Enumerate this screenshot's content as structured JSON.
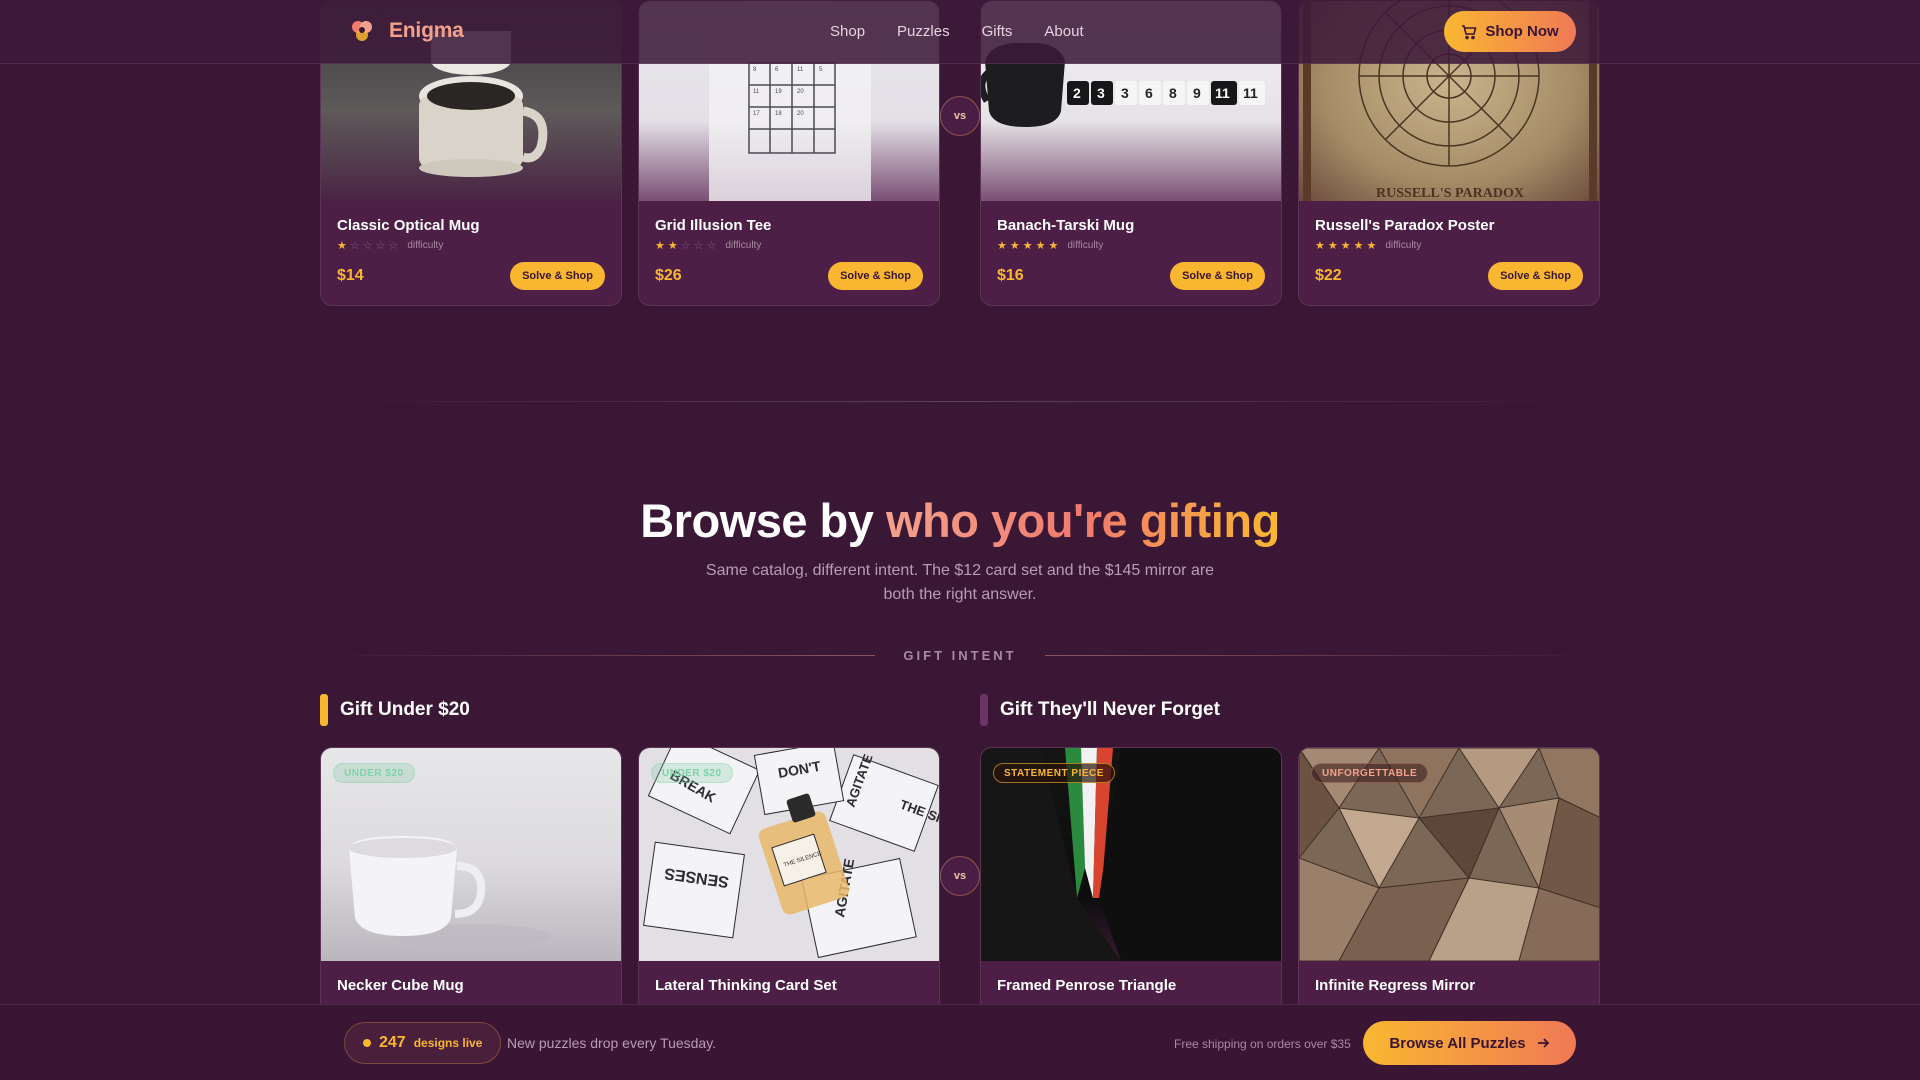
{
  "header": {
    "brand": "Enigma",
    "nav": [
      "Shop",
      "Puzzles",
      "Gifts",
      "About"
    ],
    "cta": "Shop Now"
  },
  "top_products": [
    {
      "name": "Classic Optical Mug",
      "rating": 1,
      "difficulty_label": "difficulty",
      "price": "$14",
      "button": "Solve & Shop"
    },
    {
      "name": "Grid Illusion Tee",
      "rating": 2,
      "difficulty_label": "difficulty",
      "price": "$26",
      "button": "Solve & Shop"
    },
    {
      "name": "Banach-Tarski Mug",
      "rating": 5,
      "difficulty_label": "difficulty",
      "price": "$16",
      "button": "Solve & Shop"
    },
    {
      "name": "Russell's Paradox Poster",
      "rating": 5,
      "difficulty_label": "difficulty",
      "price": "$22",
      "button": "Solve & Shop"
    }
  ],
  "vs_label": "vs",
  "poster_caption": "RUSSELL'S PARADOX",
  "mug_numbers": [
    "2",
    "3",
    "3",
    "6",
    "8",
    "9",
    "11",
    "11"
  ],
  "section": {
    "title_plain": "Browse by ",
    "title_highlight": "who you're gifting",
    "subtitle": "Same catalog, different intent. The $12 card set and the $145 mirror are both the right answer.",
    "intent_label": "GIFT INTENT"
  },
  "columns": [
    {
      "title": "Gift Under $20",
      "bar_color": "#f9b731"
    },
    {
      "title": "Gift They'll Never Forget",
      "bar_color": "#6b3466"
    }
  ],
  "gift_products": [
    {
      "name": "Necker Cube Mug",
      "badge": "UNDER $20"
    },
    {
      "name": "Lateral Thinking Card Set",
      "badge": "UNDER $20"
    },
    {
      "name": "Framed Penrose Triangle",
      "badge": "STATEMENT PIECE"
    },
    {
      "name": "Infinite Regress Mirror",
      "badge": "UNFORGETTABLE"
    }
  ],
  "card_words": [
    "BREAK",
    "DON'T",
    "AGITATE",
    "THE SI",
    "SENSES",
    "AGITATE",
    "THE SILENCE"
  ],
  "footer": {
    "count": "247",
    "count_label": "designs live",
    "drop_text": "New puzzles drop every Tuesday.",
    "shipping": "Free shipping on orders over $35",
    "cta": "Browse All Puzzles"
  }
}
